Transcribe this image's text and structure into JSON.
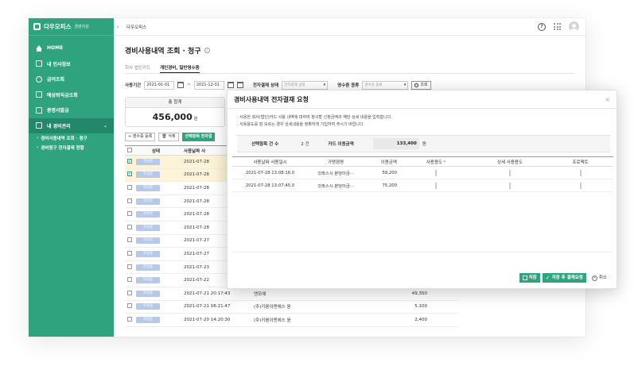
{
  "brand": {
    "name": "다우오피스",
    "sub": "경영지원"
  },
  "menu": [
    {
      "label": "HOME",
      "icon": "home-icon"
    },
    {
      "label": "내 인사정보",
      "icon": "id-card-icon"
    },
    {
      "label": "급여조회",
      "icon": "coin-icon"
    },
    {
      "label": "예상퇴직금조회",
      "icon": "calculator-icon"
    },
    {
      "label": "증명서발급",
      "icon": "document-icon"
    },
    {
      "label": "내 경비관리",
      "icon": "receipt-icon",
      "active": true
    }
  ],
  "submenu": [
    "경비사용내역 조회 · 청구",
    "경비청구 전자결재 현황"
  ],
  "topbar": {
    "tab": "다우오피스",
    "help": "?"
  },
  "page": {
    "title": "경비사용내역 조회 · 청구",
    "info": "i",
    "tabs": [
      "회사 법인카드",
      "개인경비, 일반영수증"
    ]
  },
  "filter": {
    "period_label": "사용기간",
    "start": "2021-01-01",
    "tilde": "~",
    "end": "2021-12-31",
    "approval_label": "전자결재 상태",
    "approval_placeholder": "전자결재 상태",
    "receipt_label": "영수증 종류",
    "receipt_placeholder": "영수증 종류",
    "search": "조회"
  },
  "summary": {
    "label": "총 합계",
    "value": "456,000",
    "unit": "원"
  },
  "toolbar": {
    "add": "+ 영수증 등록",
    "delete": "삭제",
    "approve": "선택항목 전자결"
  },
  "table": {
    "headers": {
      "state": "상태",
      "date": "사용날짜 사"
    },
    "rows": [
      {
        "checked": true,
        "state": "작성중",
        "date": "2021-07-28",
        "vendor": "",
        "amount": ""
      },
      {
        "checked": true,
        "state": "작성중",
        "date": "2021-07-28",
        "vendor": "",
        "amount": ""
      },
      {
        "checked": false,
        "state": "작성중",
        "date": "2021-07-28",
        "vendor": "",
        "amount": ""
      },
      {
        "checked": false,
        "state": "작성중",
        "date": "2021-07-28",
        "vendor": "",
        "amount": ""
      },
      {
        "checked": false,
        "state": "작성중",
        "date": "2021-07-28",
        "vendor": "",
        "amount": ""
      },
      {
        "checked": false,
        "state": "작성중",
        "date": "2021-07-28",
        "vendor": "",
        "amount": ""
      },
      {
        "checked": false,
        "state": "작성중",
        "date": "2021-07-27",
        "vendor": "",
        "amount": ""
      },
      {
        "checked": false,
        "state": "작성중",
        "date": "2021-07-27",
        "vendor": "",
        "amount": ""
      },
      {
        "checked": false,
        "state": "작성중",
        "date": "2021-07-23",
        "vendor": "",
        "amount": ""
      },
      {
        "checked": false,
        "state": "작성중",
        "date": "2021-07-22",
        "vendor": "",
        "amount": ""
      },
      {
        "checked": false,
        "state": "작성중",
        "date": "2021-07-21 20:17:43",
        "vendor": "엔모예",
        "amount": "49,350"
      },
      {
        "checked": false,
        "state": "작성중",
        "date": "2021-07-21 08:21:47",
        "vendor": "(주)키움이엔에스 웅",
        "amount": "5,100"
      },
      {
        "checked": false,
        "state": "작성중",
        "date": "2021-07-20 14:20:30",
        "vendor": "(주)키움이엔에스 웅",
        "amount": "2,400"
      }
    ]
  },
  "modal": {
    "title": "경비사용내역 전자결재 요청",
    "close": "×",
    "notes": [
      "· 사용한 회사(법인)카드 사용 내역에 대하여 청구할 신청금액과 해당 상세 내용을 입력합니다.",
      "· 사용용도를 잘 모르는 경우 상세내용을 정확하게 기입하여 주시기 바랍니다."
    ],
    "count_label": "선택항목 건 수",
    "count_value": "2 건",
    "amount_label": "카드 이용금액",
    "amount_value": "133,400",
    "amount_unit": "원",
    "headers": [
      "사용날짜 사용일시",
      "가맹점명",
      "이용금액",
      "사용용도",
      "상세 사용용도",
      "프로젝트"
    ],
    "required_mark": "*",
    "rows": [
      {
        "date": "2021-07-28 13:08:16.0",
        "vendor": "갓파스시 분당미금···",
        "amount": "58,200"
      },
      {
        "date": "2021-07-28 13:07:45.0",
        "vendor": "갓파스시 분당미금···",
        "amount": "75,200"
      }
    ],
    "save": "저장",
    "save_request": "저장 후 결재요청",
    "cancel": "취소"
  }
}
